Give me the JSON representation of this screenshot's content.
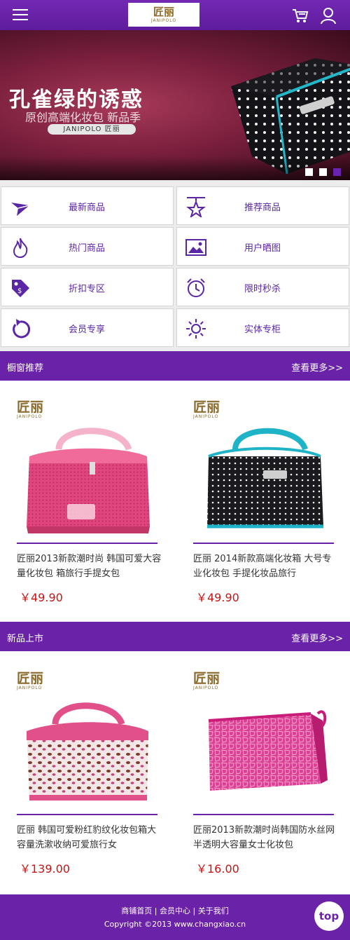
{
  "header": {
    "logo_cn": "匠丽",
    "logo_en": "JANIPOLO"
  },
  "banner": {
    "title": "孔雀绿的诱惑",
    "subtitle": "原创高端化妆包 新品季",
    "brand": "JANIPOLO 匠丽",
    "slides": 3,
    "active_slide": 3
  },
  "categories": [
    {
      "label": "最新商品",
      "icon": "paper-plane-icon"
    },
    {
      "label": "推荐商品",
      "icon": "star-icon"
    },
    {
      "label": "热门商品",
      "icon": "flame-icon"
    },
    {
      "label": "用户晒图",
      "icon": "image-icon"
    },
    {
      "label": "折扣专区",
      "icon": "price-tag-icon"
    },
    {
      "label": "限时秒杀",
      "icon": "alarm-clock-icon"
    },
    {
      "label": "会员专享",
      "icon": "refresh-icon"
    },
    {
      "label": "实体专柜",
      "icon": "sun-icon"
    }
  ],
  "sections": [
    {
      "title": "橱窗推荐",
      "more": "查看更多>>",
      "products": [
        {
          "brand_cn": "匠丽",
          "brand_en": "JANIPOLO",
          "name": "匠丽2013新款潮时尚 韩国可爱大容量化妆包 箱旅行手提女包",
          "price": "￥49.90"
        },
        {
          "brand_cn": "匠丽",
          "brand_en": "JANIPOLO",
          "name": "匠丽 2014新款高端化妆箱 大号专业化妆包 手提化妆品旅行",
          "price": "￥49.90"
        }
      ]
    },
    {
      "title": "新品上市",
      "more": "查看更多>>",
      "products": [
        {
          "brand_cn": "匠丽",
          "brand_en": "JANIPOLO",
          "name": "匠丽 韩国可爱粉红豹纹化妆包箱大容量洗漱收纳可爱旅行女",
          "price": "￥139.00"
        },
        {
          "brand_cn": "匠丽",
          "brand_en": "JANIPOLO",
          "name": "匠丽2013新款潮时尚韩国防水丝网半透明大容量女士化妆包",
          "price": "￥16.00"
        }
      ]
    }
  ],
  "footer": {
    "links": [
      "商铺首页",
      "会员中心",
      "关于我们"
    ],
    "separator": " | ",
    "copyright": "Copyright ©2013 www.changxiao.cn"
  },
  "top_button": "top",
  "colors": {
    "brand_purple": "#6a22a8",
    "price_red": "#c81414",
    "brand_gold": "#8b6a2b"
  }
}
